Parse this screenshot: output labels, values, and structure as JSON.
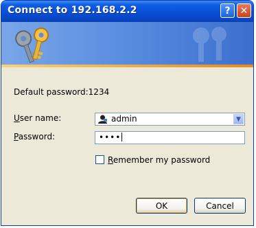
{
  "window": {
    "title": "Connect to 192.168.2.2"
  },
  "titlebar": {
    "help_glyph": "?",
    "close_glyph": "✕"
  },
  "banner": {
    "icon": "keys-icon",
    "watermark": "keys-watermark-icon"
  },
  "info": {
    "default_password_text": "Default password:1234"
  },
  "username": {
    "label_first": "U",
    "label_rest": "ser name:",
    "value": "admin",
    "icon": "user-icon"
  },
  "password": {
    "label_first": "P",
    "label_rest": "assword:",
    "value": "••••"
  },
  "remember": {
    "label_first": "R",
    "label_rest": "emember my password",
    "checked": false
  },
  "buttons": {
    "ok": "OK",
    "cancel": "Cancel"
  },
  "colors": {
    "titlebar": "#0a4fd6",
    "dialog_bg": "#ece9d8",
    "banner": "#5b8fe0",
    "banner_stripe": "#e58a1f"
  }
}
